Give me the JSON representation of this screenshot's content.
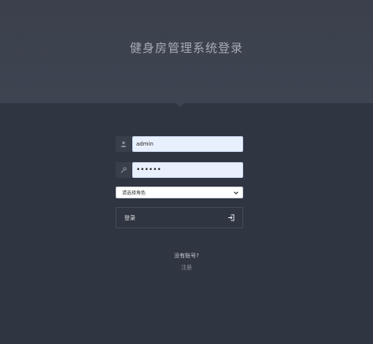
{
  "header": {
    "title": "健身房管理系统登录"
  },
  "form": {
    "username_value": "admin",
    "password_value": "••••••",
    "role_select": {
      "selected": "请选择角色"
    },
    "login_label": "登录"
  },
  "footer": {
    "no_account_text": "没有账号?",
    "register_label": "注册"
  },
  "icons": {
    "username": "user-icon",
    "password": "key-icon",
    "select": "chevron-down-icon",
    "login": "sign-in-icon"
  },
  "colors": {
    "background": "#2f3541",
    "header": "#3e4451",
    "input_fill": "#e9f0fd",
    "title_text": "#a6abb4"
  }
}
